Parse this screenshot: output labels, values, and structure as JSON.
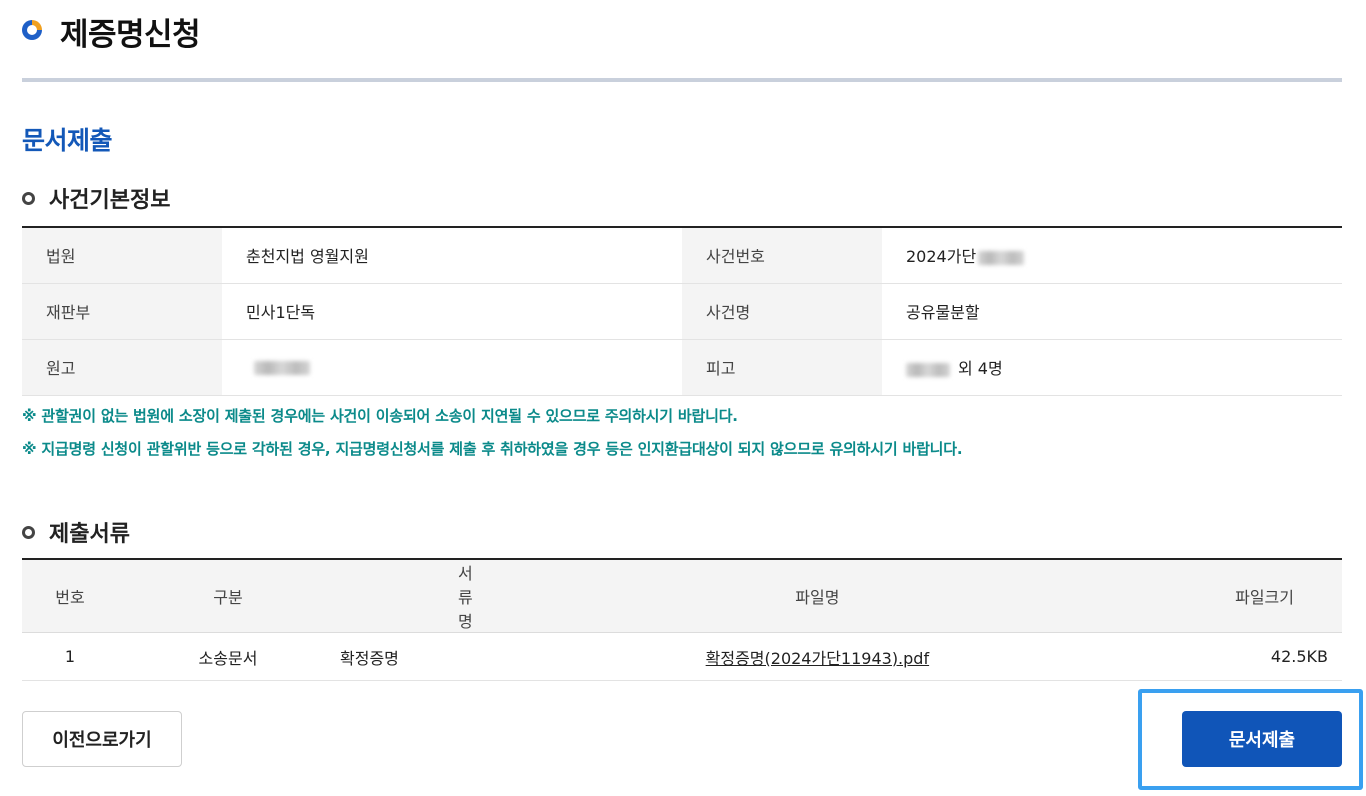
{
  "header": {
    "title": "제증명신청"
  },
  "page": {
    "subtitle": "문서제출"
  },
  "case_info": {
    "section_label": "사건기본정보",
    "rows": [
      {
        "label1": "법원",
        "value1": "춘천지법 영월지원",
        "label2": "사건번호",
        "value2": "2024가단"
      },
      {
        "label1": "재판부",
        "value1": "민사1단독",
        "label2": "사건명",
        "value2": "공유물분할"
      },
      {
        "label1": "원고",
        "value1": "",
        "label2": "피고",
        "value2": "외 4명"
      }
    ],
    "notices": [
      "※ 관할권이 없는 법원에 소장이 제출된 경우에는 사건이 이송되어 소송이 지연될 수 있으므로 주의하시기 바랍니다.",
      "※ 지급명령 신청이 관할위반 등으로 각하된 경우, 지급명령신청서를 제출 후 취하하였을 경우 등은 인지환급대상이 되지 않으므로 유의하시기 바랍니다."
    ]
  },
  "documents": {
    "section_label": "제출서류",
    "columns": [
      "번호",
      "구분",
      "서류명",
      "파일명",
      "파일크기"
    ],
    "rows": [
      {
        "no": "1",
        "type": "소송문서",
        "name": "확정증명",
        "file": "확정증명(2024가단11943).pdf",
        "size": "42.5KB"
      }
    ]
  },
  "actions": {
    "back_label": "이전으로가기",
    "submit_label": "문서제출"
  },
  "colors": {
    "accent_blue": "#1055b8",
    "notice_teal": "#0b8a8a",
    "focus_ring": "#3aa0f0"
  }
}
